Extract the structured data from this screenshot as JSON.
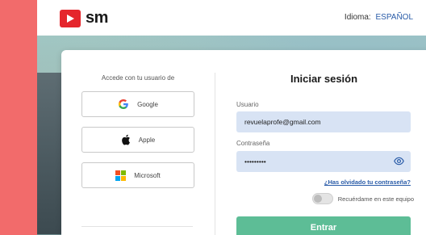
{
  "header": {
    "brand": "sm",
    "language_label": "Idioma:",
    "language_value": "ESPAÑOL"
  },
  "social_login": {
    "title": "Accede con tu usuario de",
    "providers": [
      {
        "label": "Google",
        "icon": "google-icon"
      },
      {
        "label": "Apple",
        "icon": "apple-icon"
      },
      {
        "label": "Microsoft",
        "icon": "microsoft-icon"
      }
    ]
  },
  "login": {
    "title": "Iniciar sesión",
    "username_label": "Usuario",
    "username_value": "revuelaprofe@gmail.com",
    "password_label": "Contraseña",
    "password_value": "•••••••••",
    "forgot_link": "¿Has olvidado tu contraseña?",
    "remember_label": "Recuérdame en este equipo",
    "remember_checked": false,
    "submit_label": "Entrar"
  },
  "colors": {
    "brand_red": "#e5262c",
    "accent_blue": "#2a5ca8",
    "submit_green": "#5dbd96",
    "input_bg": "#d8e3f4"
  }
}
